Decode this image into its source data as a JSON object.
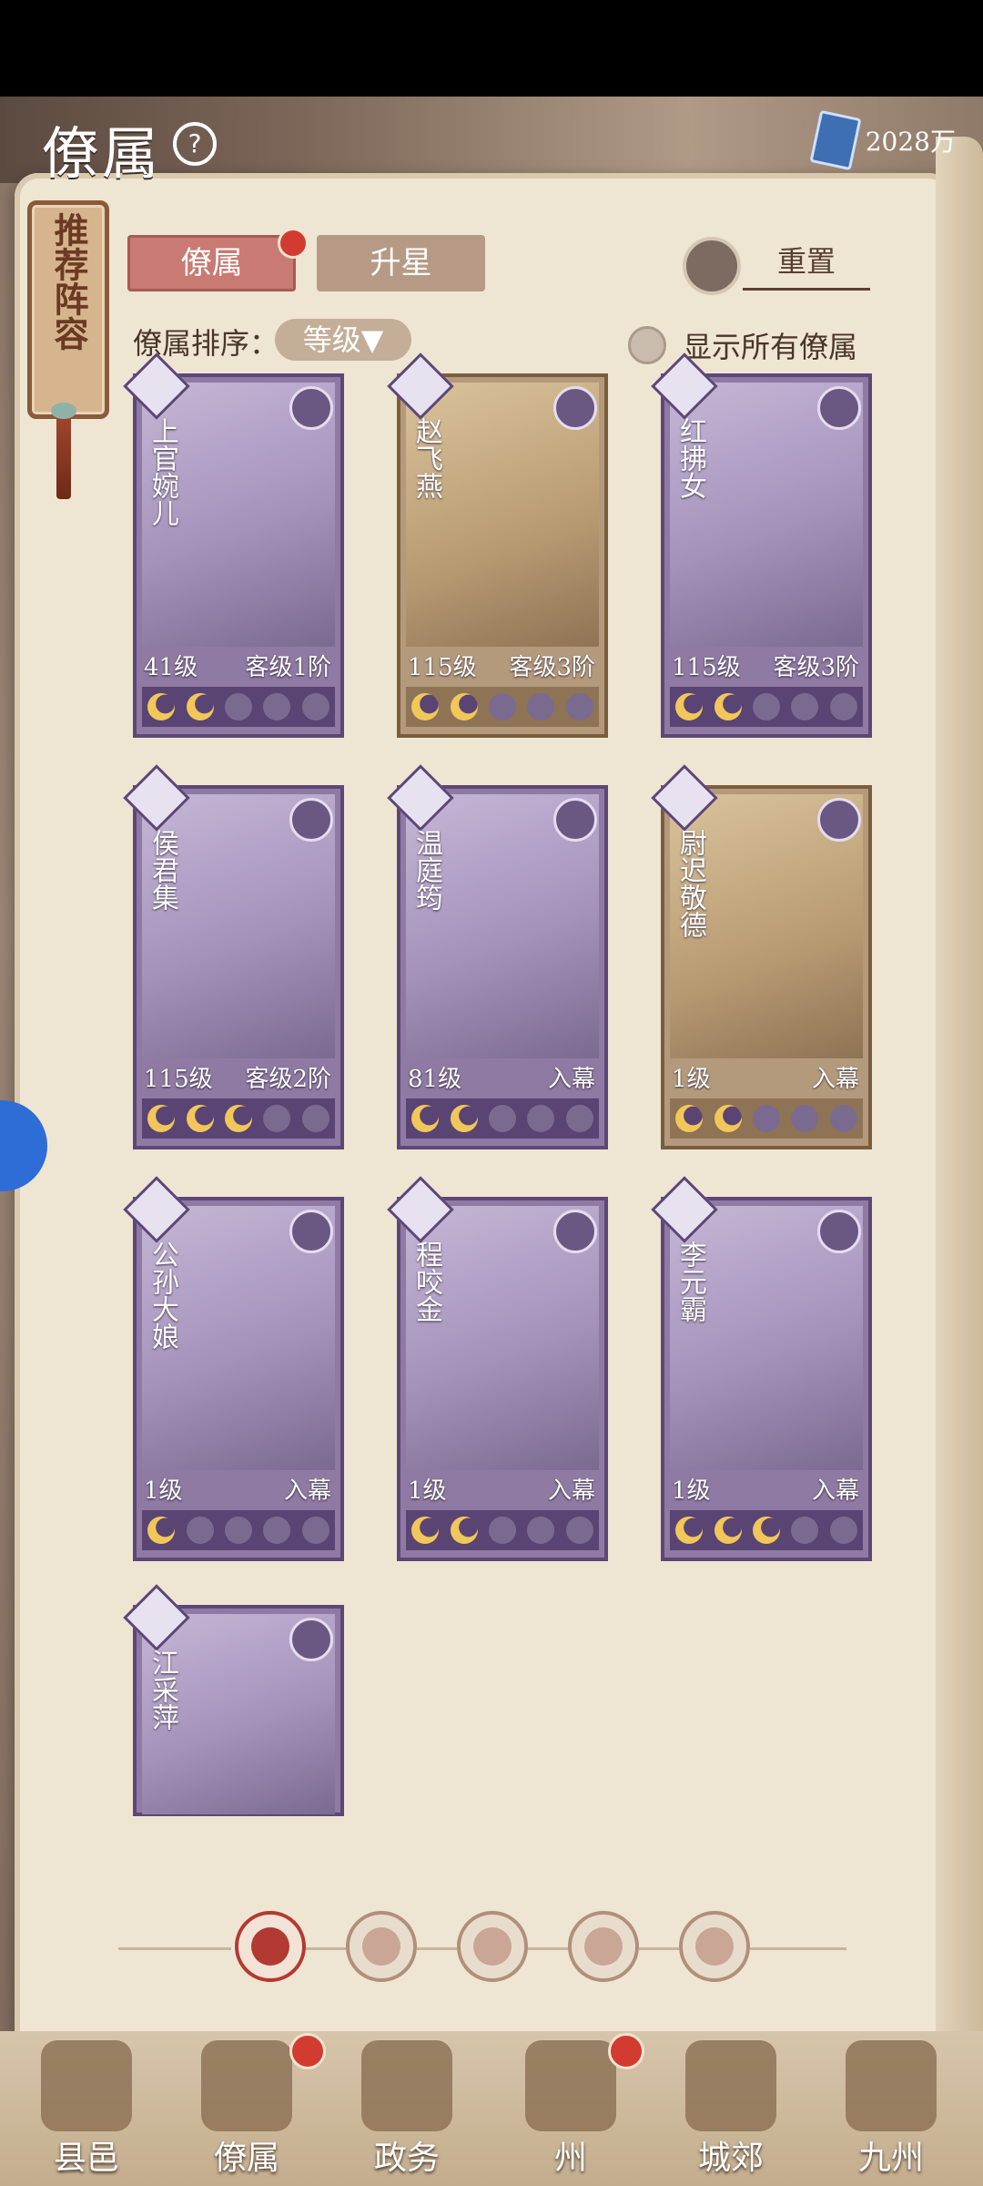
{
  "header": {
    "title": "僚属",
    "help_icon": "question-icon",
    "currency_value": "2028万"
  },
  "side_tag": {
    "label": "推荐阵容"
  },
  "tabs": [
    {
      "label": "僚属"
    },
    {
      "label": "升星"
    }
  ],
  "reset": {
    "label": "重置"
  },
  "sort": {
    "label": "僚属排序：",
    "selected": "等级▼"
  },
  "show_all": {
    "label": "显示所有僚属"
  },
  "cards": [
    {
      "name": "上官婉儿",
      "level": "41级",
      "rank": "客级1阶",
      "stars": 2,
      "style": "purple"
    },
    {
      "name": "赵飞燕",
      "level": "115级",
      "rank": "客级3阶",
      "stars": 2,
      "style": "gold"
    },
    {
      "name": "红拂女",
      "level": "115级",
      "rank": "客级3阶",
      "stars": 2,
      "style": "purple"
    },
    {
      "name": "侯君集",
      "level": "115级",
      "rank": "客级2阶",
      "stars": 3,
      "style": "purple"
    },
    {
      "name": "温庭筠",
      "level": "81级",
      "rank": "入幕",
      "stars": 2,
      "style": "purple"
    },
    {
      "name": "尉迟敬德",
      "level": "1级",
      "rank": "入幕",
      "stars": 2,
      "style": "gold"
    },
    {
      "name": "公孙大娘",
      "level": "1级",
      "rank": "入幕",
      "stars": 1,
      "style": "purple"
    },
    {
      "name": "程咬金",
      "level": "1级",
      "rank": "入幕",
      "stars": 2,
      "style": "purple"
    },
    {
      "name": "李元霸",
      "level": "1级",
      "rank": "入幕",
      "stars": 3,
      "style": "purple"
    },
    {
      "name": "江采萍",
      "level": "",
      "rank": "",
      "stars": 0,
      "style": "purple"
    }
  ],
  "bottom_filters": [
    "all-icon",
    "bell-icon",
    "lion-icon",
    "fan-icon",
    "beast-icon"
  ],
  "nav": [
    {
      "label": "县邑",
      "icon": "town-icon"
    },
    {
      "label": "僚属",
      "icon": "scroll-icon"
    },
    {
      "label": "政务",
      "icon": "document-icon"
    },
    {
      "label": "州",
      "icon": "mountain-icon"
    },
    {
      "label": "城郊",
      "icon": "garden-icon"
    },
    {
      "label": "九州",
      "icon": "map-icon"
    }
  ]
}
